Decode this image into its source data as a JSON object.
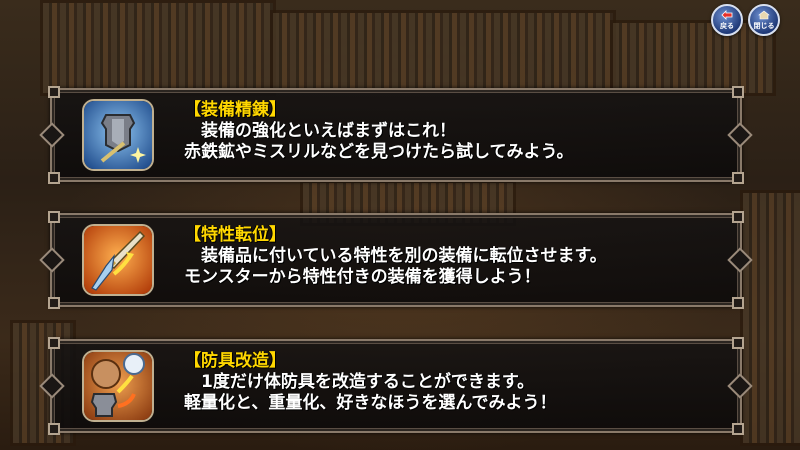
{
  "header": {
    "back_button": {
      "icon": "back-icon",
      "label": "戻る"
    },
    "close_button": {
      "icon": "home-icon",
      "label": "閉じる"
    }
  },
  "panels": [
    {
      "title": "【装備精錬】",
      "line1": "装備の強化といえばまずはこれ！",
      "line2": "赤鉄鉱やミスリルなどを見つけたら試してみよう。",
      "icon": "armor-refine-icon",
      "icon_bg": "#4a86c8"
    },
    {
      "title": "【特性転位】",
      "line1": "装備品に付いている特性を別の装備に転位させます。",
      "line2": "モンスターから特性付きの装備を獲得しよう！",
      "icon": "sword-transfer-icon",
      "icon_bg": "#e07020"
    },
    {
      "title": "【防具改造】",
      "line1": "1度だけ体防具を改造することができます。",
      "line2": "軽量化と、重量化、好きなほうを選んでみよう！",
      "icon": "armor-modify-icon",
      "icon_bg": "#c86018"
    }
  ],
  "colors": {
    "title": "#ffd700",
    "text": "#ffffff",
    "frame": "#8a7a6a"
  }
}
